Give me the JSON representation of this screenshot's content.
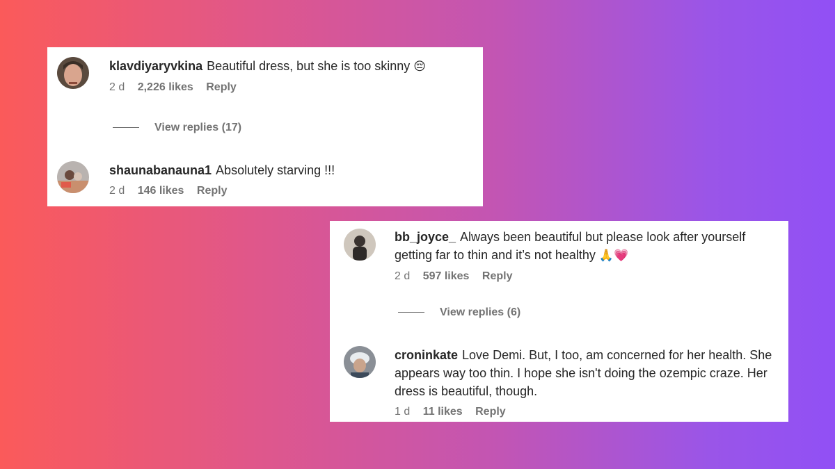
{
  "comments": [
    {
      "username": "klavdiyaryvkina",
      "text": "Beautiful dress, but she is too skinny",
      "emoji": "😔",
      "time": "2 d",
      "likes": "2,226 likes",
      "reply": "Reply",
      "view_replies": "View replies (17)"
    },
    {
      "username": "shaunabanauna1",
      "text": "Absolutely starving !!!",
      "emoji": "",
      "time": "2 d",
      "likes": "146 likes",
      "reply": "Reply"
    },
    {
      "username": "bb_joyce_",
      "text": "Always been beautiful but please look after yourself getting far to thin and it’s not healthy",
      "emoji": "🙏💗",
      "time": "2 d",
      "likes": "597 likes",
      "reply": "Reply",
      "view_replies": "View replies (6)"
    },
    {
      "username": "croninkate",
      "text": "Love Demi. But, I too, am concerned for her health. She appears way too thin. I hope she isn't doing the ozempic craze. Her dress is beautiful, though.",
      "emoji": "",
      "time": "1 d",
      "likes": "11 likes",
      "reply": "Reply"
    }
  ]
}
